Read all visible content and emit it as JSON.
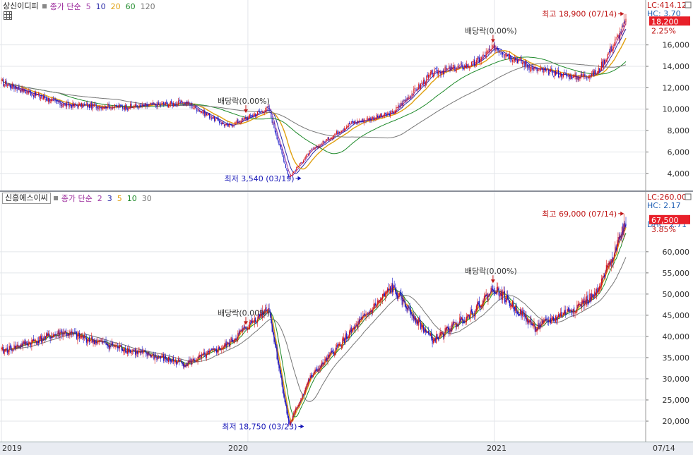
{
  "panes": [
    {
      "name": "상신이디피",
      "indicator": "종가 단순",
      "periods": [
        {
          "label": "5",
          "color": "#a23ea8"
        },
        {
          "label": "10",
          "color": "#2a2aa8"
        },
        {
          "label": "20",
          "color": "#e0a010"
        },
        {
          "label": "60",
          "color": "#1e8a2a"
        },
        {
          "label": "120",
          "color": "#777777"
        }
      ],
      "lc_label": "LC:414.12",
      "hc_label": "HC: 3.70",
      "current_label": "18,200",
      "change_label": "2.25%",
      "ymin": 2800,
      "ymax": 19800,
      "yticks": [
        "4,000",
        "6,000",
        "8,000",
        "10,000",
        "12,000",
        "14,000",
        "16,000"
      ],
      "high_label": "최고 18,900 (07/14)",
      "low_label": "최저 3,540 (03/19)",
      "dividend_labels": [
        "배당락(0.00%)",
        "배당락(0.00%)"
      ]
    },
    {
      "name": "신흥에스이씨",
      "indicator": "종가 단순",
      "periods": [
        {
          "label": "2",
          "color": "#a23ea8"
        },
        {
          "label": "3",
          "color": "#2a2aa8"
        },
        {
          "label": "5",
          "color": "#e0a010"
        },
        {
          "label": "10",
          "color": "#1e8a2a"
        },
        {
          "label": "30",
          "color": "#777777"
        }
      ],
      "lc_label": "LC:260.00",
      "hc_label": "HC: 2.17",
      "dhc_label": "DHC: 2.71",
      "current_label": "67,500",
      "change_label": "3.85%",
      "ymin": 16500,
      "ymax": 72800,
      "yticks": [
        "20,000",
        "25,000",
        "30,000",
        "35,000",
        "40,000",
        "45,000",
        "50,000",
        "55,000",
        "60,000"
      ],
      "high_label": "최고 69,000 (07/14)",
      "low_label": "최저 18,750 (03/23)",
      "dividend_labels": [
        "배당락(0.00%)",
        "배당락(0.00%)"
      ]
    }
  ],
  "x_axis": [
    "2019",
    "2020",
    "2021",
    "07/14"
  ],
  "colors": {
    "up": "#d81818",
    "down": "#1818c8",
    "accent": "#e8202a"
  },
  "chart_data": [
    {
      "type": "candlestick",
      "title": "상신이디피",
      "x": [
        "2019-01",
        "2019-04",
        "2019-07",
        "2019-10",
        "2019-12",
        "2020-02",
        "2020-03",
        "2020-04",
        "2020-06",
        "2020-08",
        "2020-10",
        "2020-12",
        "2021-01",
        "2021-03",
        "2021-05",
        "2021-06",
        "2021-07-14"
      ],
      "close": [
        12500,
        10400,
        10200,
        10600,
        8400,
        10100,
        3600,
        6000,
        8700,
        9600,
        13400,
        14200,
        15800,
        13700,
        13000,
        13400,
        18200
      ],
      "high": 18900,
      "low": 3540,
      "ylim": [
        2800,
        19800
      ],
      "moving_averages": [
        "5",
        "10",
        "20",
        "60",
        "120"
      ]
    },
    {
      "type": "candlestick",
      "title": "신흥에스이씨",
      "x": [
        "2019-01",
        "2019-04",
        "2019-07",
        "2019-10",
        "2019-12",
        "2020-02",
        "2020-03",
        "2020-04",
        "2020-06",
        "2020-08",
        "2020-10",
        "2020-12",
        "2021-01",
        "2021-03",
        "2021-05",
        "2021-06",
        "2021-07-14"
      ],
      "close": [
        36500,
        41000,
        37000,
        33500,
        38000,
        47000,
        19000,
        30000,
        41000,
        51500,
        39000,
        46000,
        51500,
        42000,
        47000,
        50000,
        67500
      ],
      "high": 69000,
      "low": 18750,
      "ylim": [
        16500,
        72800
      ],
      "moving_averages": [
        "2",
        "3",
        "5",
        "10",
        "30"
      ]
    }
  ]
}
